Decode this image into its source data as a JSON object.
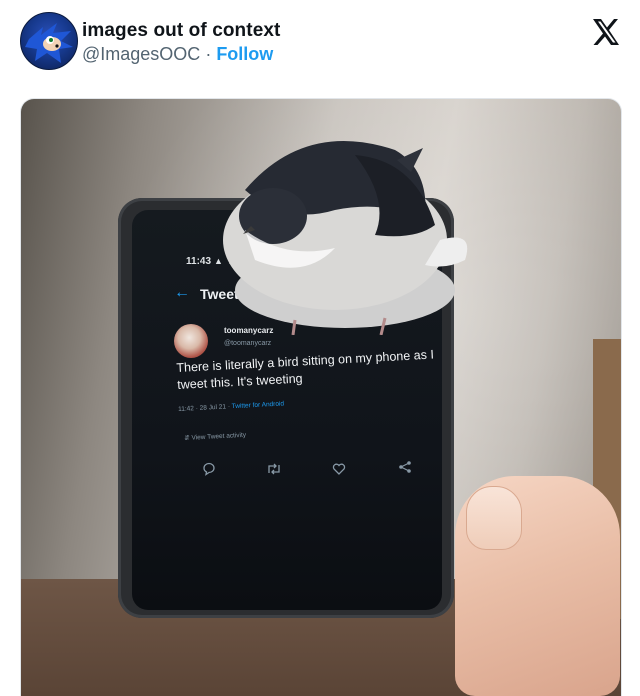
{
  "post": {
    "display_name": "images out of context",
    "handle": "@ImagesOOC",
    "separator": " · ",
    "follow_label": "Follow",
    "brand_icon": "x-logo-icon"
  },
  "photo": {
    "phone": {
      "status_time": "11:43",
      "status_icons": "▲ ▲ ✦ ▬ •",
      "status_right": "▾ ▮",
      "screen_title": "Tweet",
      "tweet": {
        "author_name": "toomanycarz",
        "author_handle": "@toomanycarz",
        "text": "There is literally a bird sitting on my phone as I tweet this. It's tweeting",
        "time": "11:42 · 28 Jul 21 · ",
        "source": "Twitter for Android",
        "activity": "View Tweet activity"
      },
      "actions": [
        "reply-icon",
        "retweet-icon",
        "like-icon",
        "share-icon"
      ]
    }
  },
  "colors": {
    "accent": "#1d9bf0",
    "name_text": "#0f1419",
    "handle_text": "#536471"
  }
}
